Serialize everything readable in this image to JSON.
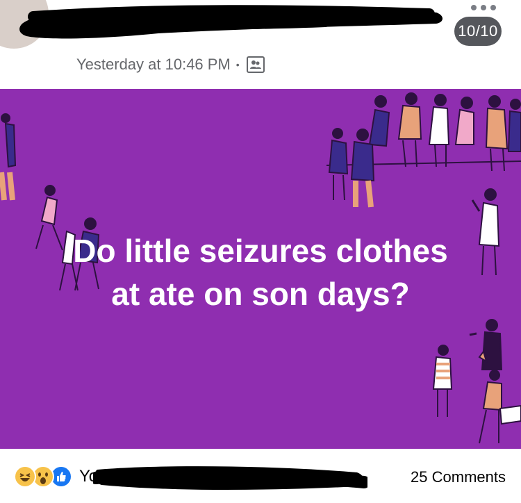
{
  "header": {
    "page_counter": "10/10",
    "timestamp": "Yesterday at 10:46 PM",
    "separator": "•",
    "audience_icon": "group-icon"
  },
  "post": {
    "background_color": "#8f2eb0",
    "question_line1": "Do little seizures clothes",
    "question_line2": "at ate on son days?"
  },
  "footer": {
    "reactions": [
      "haha-icon",
      "wow-icon",
      "like-icon"
    ],
    "you_label": "You",
    "comments": "25 Comments"
  }
}
